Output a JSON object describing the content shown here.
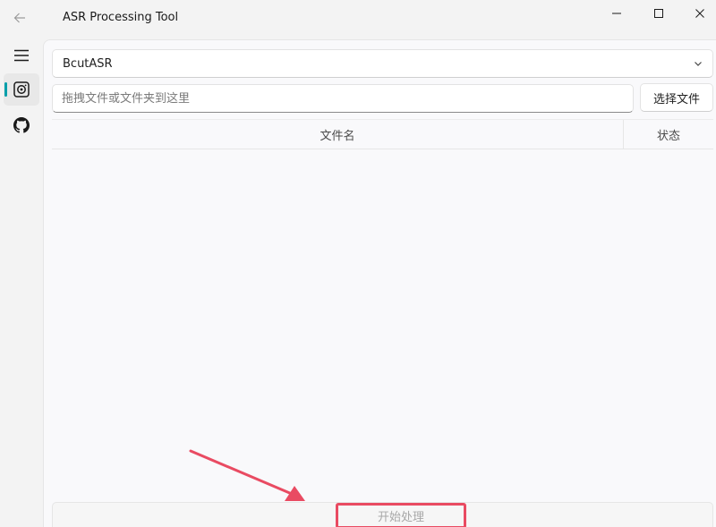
{
  "window": {
    "title": "ASR Processing Tool",
    "controls": [
      "minimize-icon",
      "maximize-icon",
      "close-icon"
    ]
  },
  "sidebar": {
    "items": [
      {
        "icon": "menu-icon"
      },
      {
        "icon": "asr-icon",
        "selected": true
      },
      {
        "icon": "github-icon"
      }
    ],
    "accent_color": "#009faa"
  },
  "main": {
    "asr_engine": {
      "selected": "BcutASR"
    },
    "file_input": {
      "placeholder": "拖拽文件或文件夹到这里",
      "value": ""
    },
    "select_file_label": "选择文件",
    "table": {
      "columns": [
        "文件名",
        "状态"
      ],
      "rows": []
    },
    "start_label": "开始处理"
  },
  "annotation": {
    "highlight_color": "#e94b62"
  }
}
